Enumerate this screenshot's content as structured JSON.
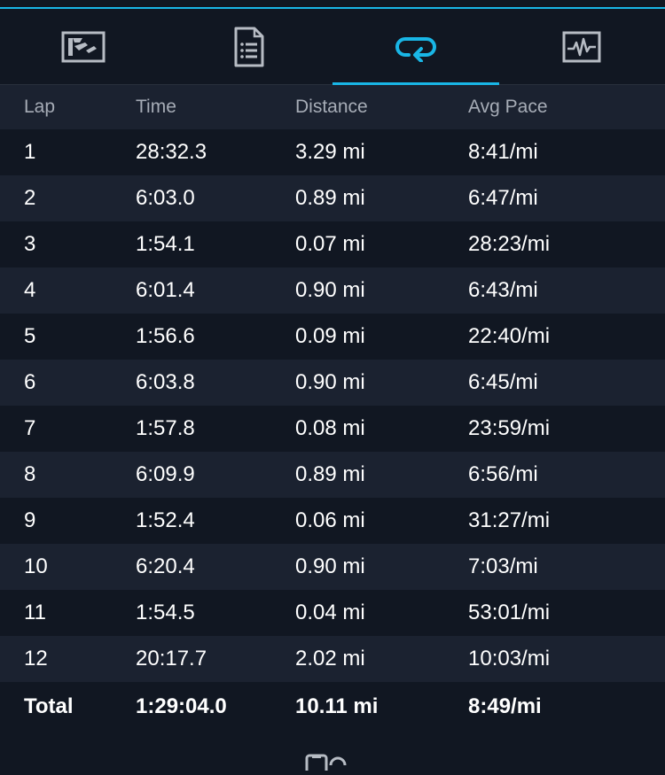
{
  "tabs": [
    {
      "icon": "map-overview-icon",
      "active": false
    },
    {
      "icon": "notes-list-icon",
      "active": false
    },
    {
      "icon": "laps-repeat-icon",
      "active": true
    },
    {
      "icon": "heart-rate-chart-icon",
      "active": false
    }
  ],
  "colors": {
    "accent": "#19b6e6",
    "background": "#111722",
    "row_alt": "#1b2230",
    "header_text": "#a6acb6"
  },
  "table": {
    "headers": {
      "lap": "Lap",
      "time": "Time",
      "distance": "Distance",
      "pace": "Avg Pace"
    },
    "rows": [
      {
        "lap": "1",
        "time": "28:32.3",
        "distance": "3.29 mi",
        "pace": "8:41/mi"
      },
      {
        "lap": "2",
        "time": "6:03.0",
        "distance": "0.89 mi",
        "pace": "6:47/mi"
      },
      {
        "lap": "3",
        "time": "1:54.1",
        "distance": "0.07 mi",
        "pace": "28:23/mi"
      },
      {
        "lap": "4",
        "time": "6:01.4",
        "distance": "0.90 mi",
        "pace": "6:43/mi"
      },
      {
        "lap": "5",
        "time": "1:56.6",
        "distance": "0.09 mi",
        "pace": "22:40/mi"
      },
      {
        "lap": "6",
        "time": "6:03.8",
        "distance": "0.90 mi",
        "pace": "6:45/mi"
      },
      {
        "lap": "7",
        "time": "1:57.8",
        "distance": "0.08 mi",
        "pace": "23:59/mi"
      },
      {
        "lap": "8",
        "time": "6:09.9",
        "distance": "0.89 mi",
        "pace": "6:56/mi"
      },
      {
        "lap": "9",
        "time": "1:52.4",
        "distance": "0.06 mi",
        "pace": "31:27/mi"
      },
      {
        "lap": "10",
        "time": "6:20.4",
        "distance": "0.90 mi",
        "pace": "7:03/mi"
      },
      {
        "lap": "11",
        "time": "1:54.5",
        "distance": "0.04 mi",
        "pace": "53:01/mi"
      },
      {
        "lap": "12",
        "time": "20:17.7",
        "distance": "2.02 mi",
        "pace": "10:03/mi"
      }
    ],
    "total": {
      "lap": "Total",
      "time": "1:29:04.0",
      "distance": "10.11 mi",
      "pace": "8:49/mi"
    }
  },
  "bottom_icon": "device-sync-icon"
}
